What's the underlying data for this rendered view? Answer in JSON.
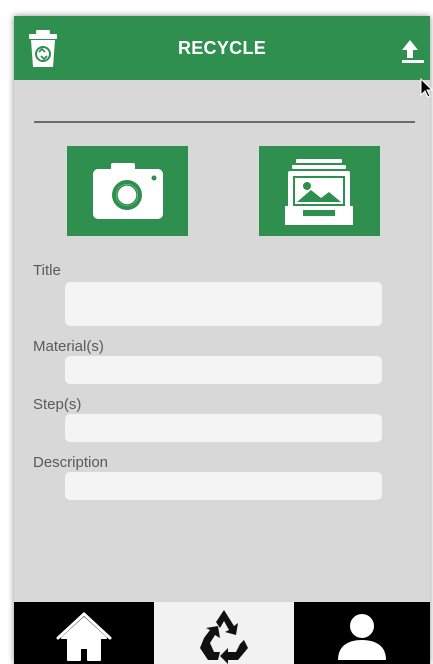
{
  "appbar": {
    "title": "RECYCLE",
    "left_icon": "trash-icon",
    "right_icon": "upload-icon"
  },
  "media": {
    "camera_icon": "camera-icon",
    "gallery_icon": "gallery-icon"
  },
  "form": {
    "title_label": "Title",
    "title_value": "",
    "materials_label": "Material(s)",
    "materials_value": "",
    "steps_label": "Step(s)",
    "steps_value": "",
    "description_label": "Description",
    "description_value": ""
  },
  "bottom_nav": {
    "items": [
      {
        "icon": "home-icon",
        "selected": false
      },
      {
        "icon": "recycle-icon",
        "selected": true
      },
      {
        "icon": "profile-icon",
        "selected": false
      }
    ]
  },
  "colors": {
    "primary": "#2f8f4e",
    "background": "#d8d8d8",
    "field": "#f4f4f4",
    "nav": "#000000",
    "nav_selected": "#f2f2f2"
  }
}
